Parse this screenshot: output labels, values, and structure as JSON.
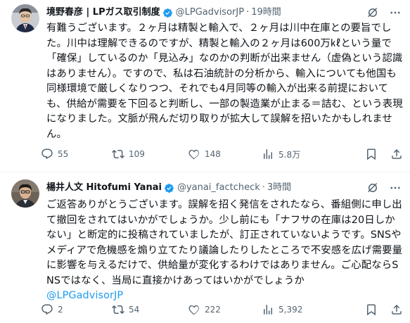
{
  "tweets": [
    {
      "author": "境野春彦 | LPガス取引制度",
      "handle": "@LPGadvisorJP",
      "separator": "·",
      "time": "19時間",
      "text": "有難うございます。２ヶ月は精製と輸入で、２ヶ月は川中在庫との要旨でした。川中は理解できるのですが、精製と輸入の２ヶ月は600万㎘という量で「確保」しているのか「見込み」なのかの判断が出来ません（虚偽という認識はありません）。ですので、私は石油統計の分析から、輸入についても他国も同様環境で厳しくなりつつ、それでも4月同等の輸入が出来る前提においても、供給が需要を下回ると判断し、一部の製造業が止まる＝詰む、という表現になりました。文脈が飛んだ切り取りが拡大して誤解を招いたかもしれません。",
      "mention": "",
      "replies": "55",
      "reposts": "109",
      "likes": "148",
      "views": "5.8万"
    },
    {
      "author": "楊井人文 Hitofumi Yanai",
      "handle": "@yanai_factcheck",
      "separator": "·",
      "time": "3時間",
      "text": "ご返答ありがとうございます。誤解を招く発信をされたなら、番組側に申し出て撤回をされてはいかがでしょうか。少し前にも「ナフサの在庫は20日しかない」と断定的に投稿されていましたが、訂正されていないようです。SNSやメディアで危機感を煽り立てたり議論したりしたところで不安感を広げ需要量に影響を与えるだけで、供給量が変化するわけではありません。ご心配ならSNSではなく、当局に直接かけあってはいかがでしょうか\n",
      "mention": "@LPGadvisorJP",
      "replies": "2",
      "reposts": "54",
      "likes": "222",
      "views": "5,392"
    }
  ],
  "colors": {
    "text": "#0f1419",
    "secondary": "#536471",
    "accent": "#1d9bf0",
    "verified": "#1d9bf0"
  },
  "icons": [
    "verified-badge-icon",
    "grok-icon",
    "more-icon",
    "reply-icon",
    "repost-icon",
    "like-icon",
    "views-icon",
    "bookmark-icon",
    "share-icon"
  ]
}
